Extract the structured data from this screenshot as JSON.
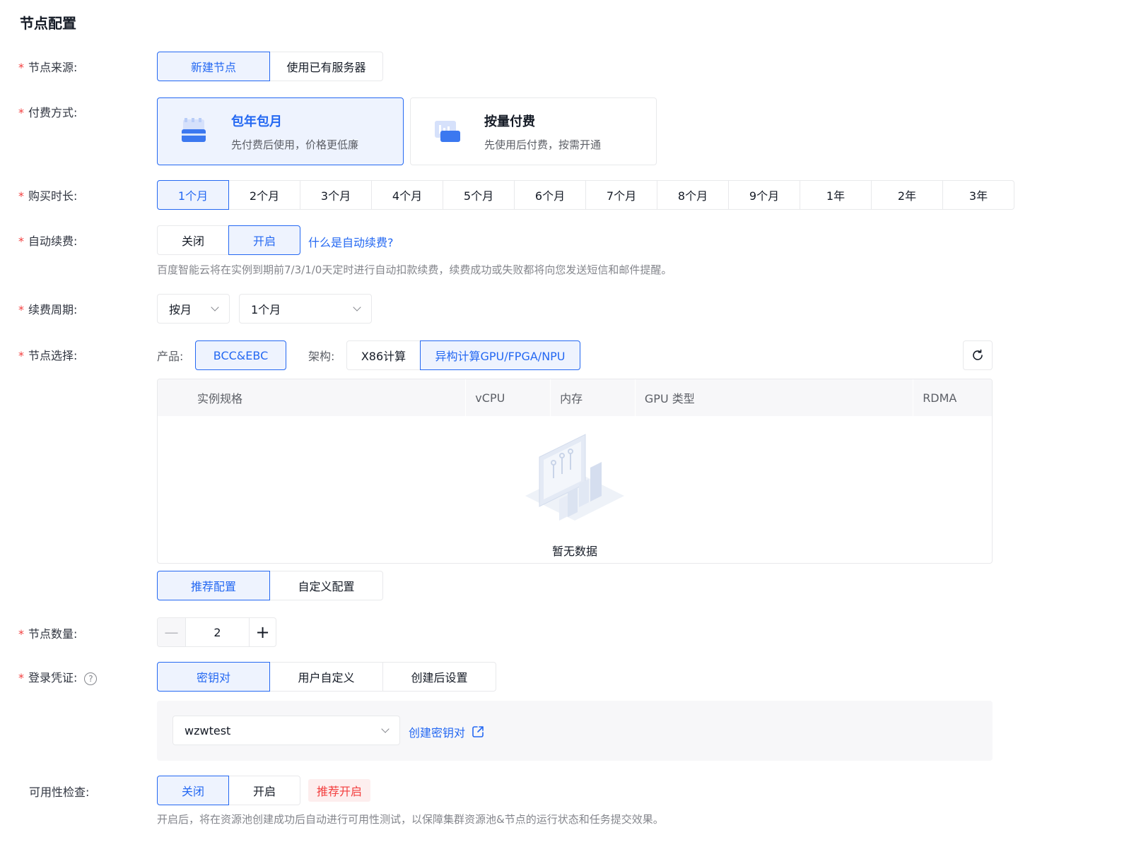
{
  "section": {
    "title": "节点配置"
  },
  "node_source": {
    "label": "节点来源:",
    "options": [
      "新建节点",
      "使用已有服务器"
    ],
    "selected": "新建节点"
  },
  "payment": {
    "label": "付费方式:",
    "cards": [
      {
        "title": "包年包月",
        "desc": "先付费后使用，价格更低廉",
        "icon": "calendar-card-icon"
      },
      {
        "title": "按量付费",
        "desc": "先使用后付费，按需开通",
        "icon": "usage-chart-icon"
      }
    ],
    "selected": "包年包月"
  },
  "duration": {
    "label": "购买时长:",
    "options": [
      "1个月",
      "2个月",
      "3个月",
      "4个月",
      "5个月",
      "6个月",
      "7个月",
      "8个月",
      "9个月",
      "1年",
      "2年",
      "3年"
    ],
    "selected": "1个月"
  },
  "auto_renew": {
    "label": "自动续费:",
    "options": [
      "关闭",
      "开启"
    ],
    "selected": "开启",
    "help_link": "什么是自动续费?",
    "hint": "百度智能云将在实例到期前7/3/1/0天定时进行自动扣款续费，续费成功或失败都将向您发送短信和邮件提醒。"
  },
  "renew_cycle": {
    "label": "续费周期:",
    "unit_value": "按月",
    "period_value": "1个月"
  },
  "node_select": {
    "label": "节点选择:",
    "product_label": "产品:",
    "product_options": [
      "BCC&EBC"
    ],
    "product_selected": "BCC&EBC",
    "arch_label": "架构:",
    "arch_options": [
      "X86计算",
      "异构计算GPU/FPGA/NPU"
    ],
    "arch_selected": "异构计算GPU/FPGA/NPU",
    "table": {
      "columns": [
        "实例规格",
        "vCPU",
        "内存",
        "GPU 类型",
        "RDMA"
      ],
      "empty_text": "暂无数据"
    },
    "config_options": [
      "推荐配置",
      "自定义配置"
    ],
    "config_selected": "推荐配置"
  },
  "node_count": {
    "label": "节点数量:",
    "value": "2",
    "minus": "—",
    "plus": "+"
  },
  "login": {
    "label": "登录凭证:",
    "help": "?",
    "options": [
      "密钥对",
      "用户自定义",
      "创建后设置"
    ],
    "selected": "密钥对",
    "keypair_value": "wzwtest",
    "create_link": "创建密钥对"
  },
  "health_check": {
    "label": "可用性检查:",
    "options": [
      "关闭",
      "开启"
    ],
    "selected": "关闭",
    "badge": "推荐开启",
    "hint": "开启后，将在资源池创建成功后自动进行可用性测试，以保障集群资源池&节点的运行状态和任务提交效果。"
  },
  "colors": {
    "primary": "#2468f2",
    "required": "#f33e3e",
    "border": "#e8e9eb",
    "active_bg": "#eef3fe"
  }
}
